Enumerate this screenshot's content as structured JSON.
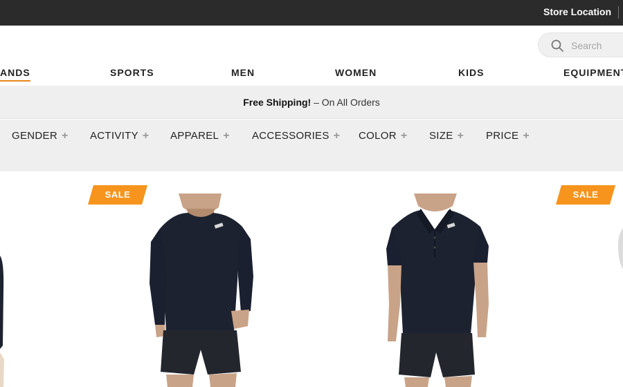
{
  "topbar": {
    "store_location": "Store Location"
  },
  "search": {
    "placeholder": "Search"
  },
  "nav": [
    {
      "label": "ANDS",
      "active": true
    },
    {
      "label": "SPORTS"
    },
    {
      "label": "MEN"
    },
    {
      "label": "WOMEN"
    },
    {
      "label": "KIDS"
    },
    {
      "label": "EQUIPMENT"
    }
  ],
  "shipping": {
    "bold": "Free Shipping!",
    "rest": " – On All Orders"
  },
  "filters": [
    "GENDER",
    "ACTIVITY",
    "APPAREL",
    "ACCESSORIES",
    "COLOR",
    "SIZE",
    "PRICE"
  ],
  "badges": [
    "SALE",
    "SALE"
  ],
  "colors": {
    "topbar": "#2b2b2b",
    "accent": "#e8861a",
    "sale": "#f7941d",
    "garment": "#1c2230"
  },
  "products": [
    {
      "image": "long-sleeve-shirt-image",
      "sale": true
    },
    {
      "image": "polo-shirt-image",
      "sale": false
    }
  ]
}
